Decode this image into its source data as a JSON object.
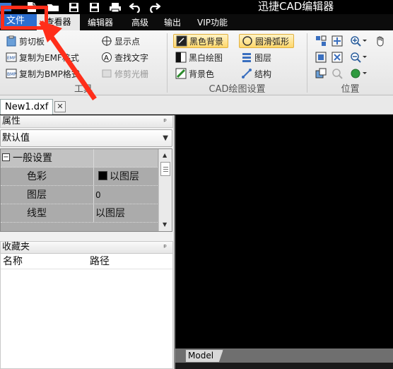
{
  "titlebar": {
    "logo_text": "CAD",
    "title": "迅捷CAD编辑器"
  },
  "menu": {
    "file": "文件",
    "tabs": [
      "查看器",
      "编辑器",
      "高级",
      "输出",
      "VIP功能"
    ]
  },
  "ribbon": {
    "tools": {
      "items": [
        "剪切板",
        "复制为EMF格式",
        "复制为BMP格式",
        "显示点",
        "查找文字",
        "修剪光栅"
      ],
      "label": "工具"
    },
    "cad_settings": {
      "items": [
        "黑色背景",
        "黑白绘图",
        "背景色",
        "圆滑弧形",
        "图层",
        "结构"
      ],
      "label": "CAD绘图设置"
    },
    "position": {
      "label": "位置"
    }
  },
  "doc": {
    "tab": "New1.dxf",
    "close": "✕"
  },
  "properties": {
    "header": "属性",
    "pin": "ᵖ",
    "combo": "默认值",
    "group": "一般设置",
    "expander": "−",
    "rows": [
      {
        "name": "色彩",
        "value": "以图层"
      },
      {
        "name": "图层",
        "value": "0"
      },
      {
        "name": "线型",
        "value": "以图层"
      }
    ]
  },
  "favorites": {
    "header": "收藏夹",
    "columns": [
      "名称",
      "路径"
    ]
  },
  "model_tab": "Model",
  "colors": {
    "accent": "#2c6fd0",
    "annotation": "#ff2e1a",
    "highlight": "#ffd76a"
  }
}
